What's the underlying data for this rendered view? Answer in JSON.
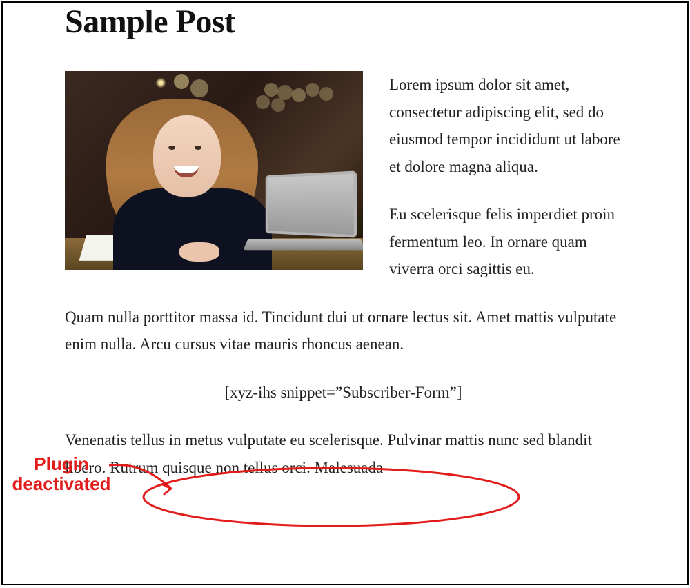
{
  "post": {
    "title": "Sample Post",
    "paragraphs": {
      "p1": "Lorem ipsum dolor sit amet, consectetur adipiscing elit, sed do eiusmod tempor incididunt ut labore et dolore magna aliqua.",
      "p2": "Eu scelerisque felis imperdiet proin fermentum leo. In ornare quam viverra orci sagittis eu.",
      "p3": "Quam nulla porttitor massa id. Tincidunt dui ut ornare lectus sit. Amet mattis vulputate enim nulla. Arcu cursus vitae mauris rhoncus aenean.",
      "p4": "Venenatis tellus in metus vulputate eu scelerisque. Pulvinar mattis nunc sed blandit libero. Rutrum quisque non tellus orci. Malesuada"
    },
    "shortcode": "[xyz-ihs snippet=”Subscriber-Form”]"
  },
  "annotation": {
    "line1": "Plugin",
    "line2": "deactivated",
    "color": "#e21b1b"
  },
  "image": {
    "alt": "Woman smiling at laptop in cafe"
  }
}
